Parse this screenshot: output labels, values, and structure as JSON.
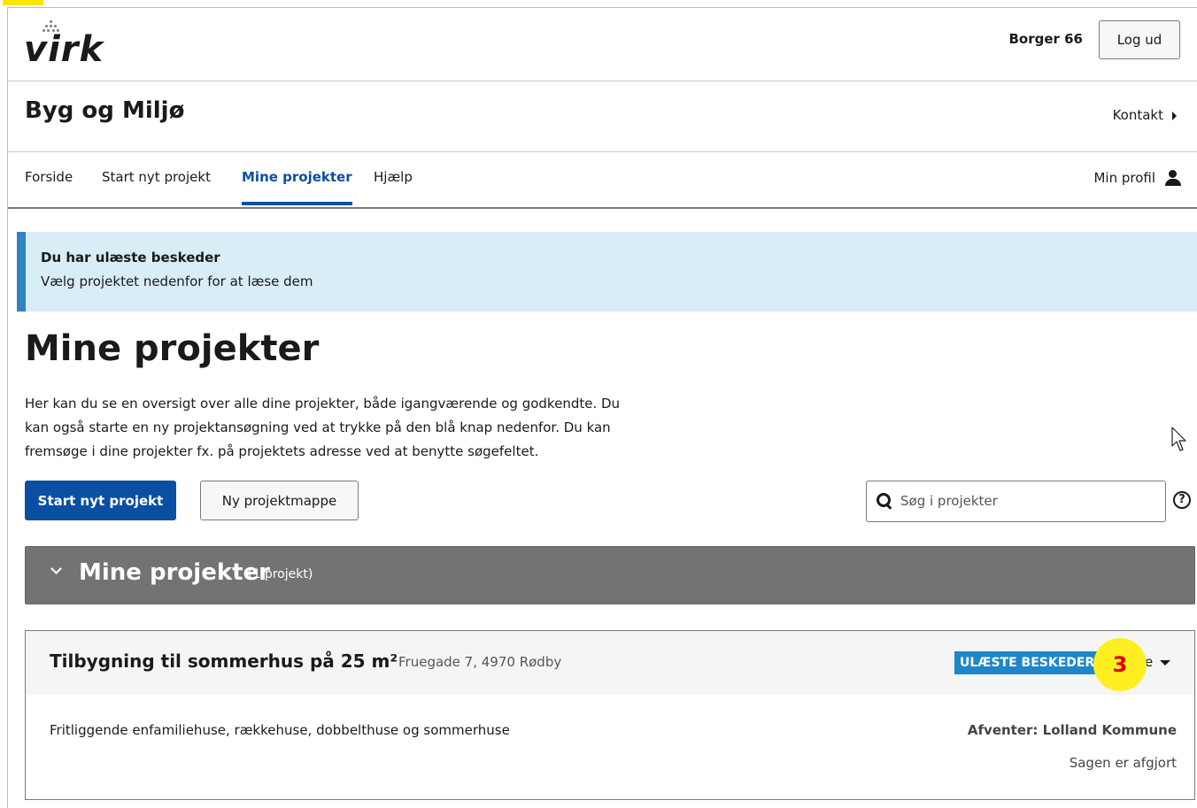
{
  "doc_top_text": "",
  "header": {
    "logo_text": "virk",
    "user_name": "Borger 66",
    "logout_label": "Log ud"
  },
  "site": {
    "title": "Byg og Miljø",
    "contact_label": "Kontakt"
  },
  "nav": {
    "items": [
      {
        "label": "Forside",
        "active": false
      },
      {
        "label": "Start nyt projekt",
        "active": false
      },
      {
        "label": "Mine projekter",
        "active": true
      },
      {
        "label": "Hjælp",
        "active": false
      }
    ],
    "profile_label": "Min profil"
  },
  "alert": {
    "title": "Du har ulæste beskeder",
    "text": "Vælg projektet nedenfor for at læse dem"
  },
  "main": {
    "title": "Mine projekter",
    "intro_lines": [
      "Her kan du se en oversigt over alle dine projekter, både igangværende og godkendte. Du",
      "kan også starte en ny projektansøgning ved at trykke på den blå knap nedenfor. Du kan",
      "fremsøge i dine projekter fx. på projektets adresse ved at benytte søgefeltet."
    ],
    "start_button": "Start nyt projekt",
    "folder_button": "Ny projektmappe",
    "search_placeholder": "Søg i projekter"
  },
  "group": {
    "title": "Mine projekter",
    "count": "(1 projekt)"
  },
  "project": {
    "title": "Tilbygning til sommerhus på 25 m²",
    "address": "Fruegade 7, 4970 Rødby",
    "badge": "ULÆSTE BESKEDER",
    "status_fragment": "e",
    "description": "Fritliggende enfamiliehuse, rækkehuse, dobbelthuse og sommerhuse",
    "waiting": "Afventer: Lolland Kommune",
    "result": "Sagen er afgjort"
  },
  "annotation": {
    "number": "3"
  },
  "colors": {
    "primary": "#0b4fa3",
    "alert_bg": "#d9edf6",
    "alert_border": "#2e85c0",
    "group_bar": "#737373",
    "badge": "#1f86c8",
    "annotation_bg": "#ffee22",
    "annotation_text": "#dd0000"
  }
}
